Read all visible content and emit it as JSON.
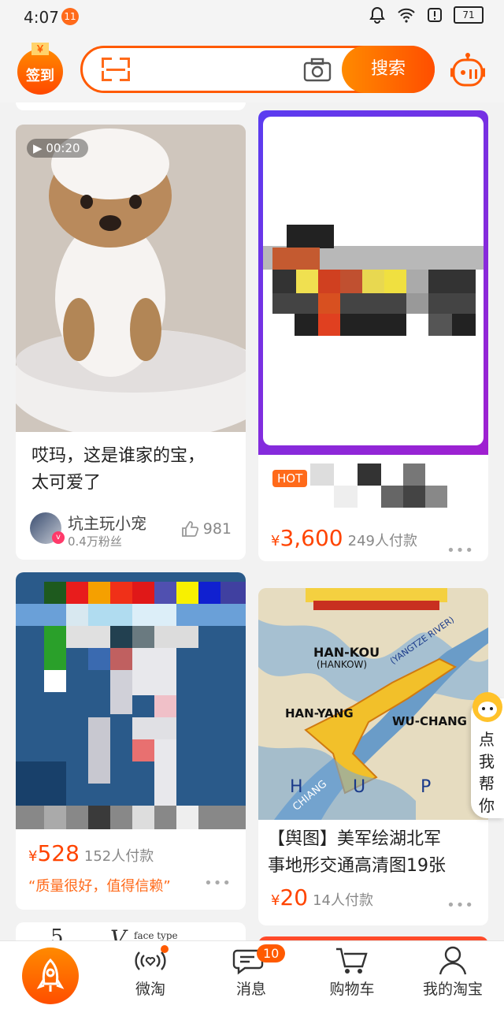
{
  "status": {
    "time": "4:07",
    "notif_count": "11",
    "battery": "71"
  },
  "header": {
    "checkin_label": "签到",
    "search_button": "搜索"
  },
  "cards": [
    {
      "badge_time": "00:20",
      "title_line1": "哎玛，这是谁家的宝，",
      "title_line2": "太可爱了",
      "author": "坑主玩小宠",
      "fans": "0.4万粉丝",
      "likes": "981"
    },
    {
      "tag": "HOT",
      "currency": "¥",
      "price": "3,600",
      "paid": "249人付款",
      "more": "•••"
    },
    {
      "currency": "¥",
      "price": "528",
      "paid": "152人付款",
      "quote": "“质量很好，值得信赖”",
      "more": "•••"
    },
    {
      "title_line1": "【舆图】美军绘湖北军",
      "title_line2": "事地形交通高清图19张",
      "currency": "¥",
      "price": "20",
      "paid": "14人付款",
      "more": "•••",
      "map_labels": [
        "HAN-KOU",
        "(HANKOW)",
        "HAN-YANG",
        "WU-CHANG",
        "(YANGTZE RIVER)",
        "CHIANG",
        "H",
        "U",
        "P"
      ]
    },
    {
      "peek": "5",
      "peek2": "V",
      "peek3": "face type"
    }
  ],
  "assistant": {
    "text": "点我帮你"
  },
  "tabbar": {
    "items": [
      "微淘",
      "消息",
      "购物车",
      "我的淘宝"
    ],
    "message_badge": "10"
  },
  "colors": {
    "accent": "#ff5a00",
    "price": "#ff4400"
  }
}
